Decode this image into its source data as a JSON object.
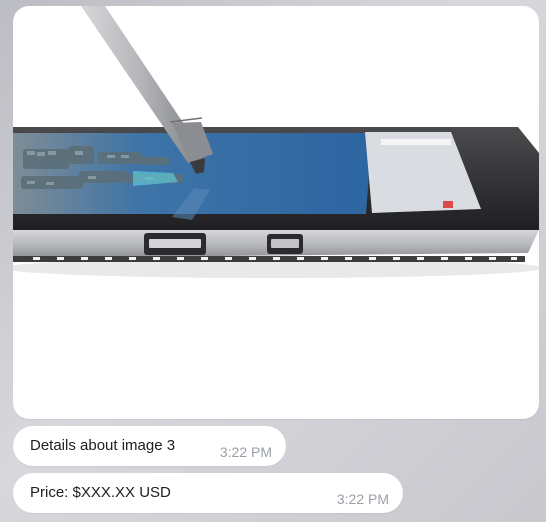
{
  "messages": [
    {
      "type": "image",
      "image_subject": "tablet-with-stylus"
    },
    {
      "type": "text",
      "text": "Details about image 3",
      "time": "3:22 PM"
    },
    {
      "type": "text",
      "text": "Price: $XXX.XX USD",
      "time": "3:22 PM"
    }
  ],
  "colors": {
    "bubble_background": "#ffffff",
    "text": "#202124",
    "timestamp": "#9aa0a6",
    "chat_background": "#cfcfd5"
  }
}
